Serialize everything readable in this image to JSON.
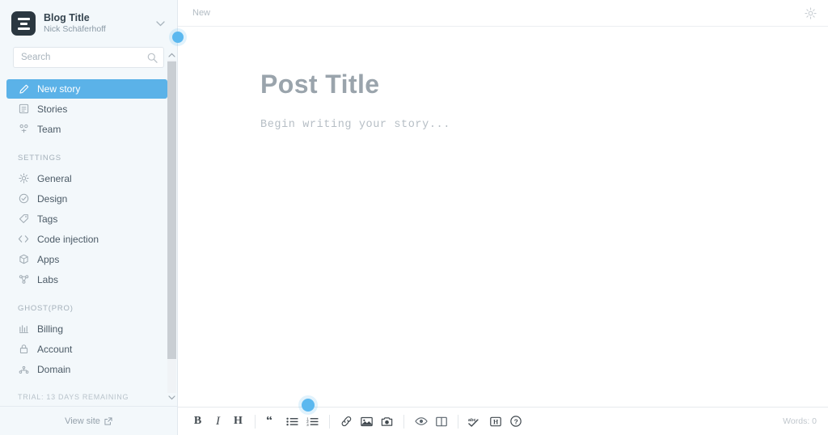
{
  "sidebar": {
    "blog": {
      "title": "Blog Title",
      "author": "Nick Schäferhoff",
      "logo_icon": "ghost-logo-icon",
      "chevron_icon": "chevron-down-icon"
    },
    "search": {
      "placeholder": "Search",
      "value": "",
      "icon": "search-icon"
    },
    "primary_items": [
      {
        "label": "New story",
        "icon": "pencil-icon",
        "active": true
      },
      {
        "label": "Stories",
        "icon": "content-list-icon",
        "active": false
      },
      {
        "label": "Team",
        "icon": "team-icon",
        "active": false
      }
    ],
    "settings_heading": "SETTINGS",
    "settings_items": [
      {
        "label": "General",
        "icon": "gear-icon"
      },
      {
        "label": "Design",
        "icon": "paintbrush-icon"
      },
      {
        "label": "Tags",
        "icon": "tag-icon"
      },
      {
        "label": "Code injection",
        "icon": "code-icon"
      },
      {
        "label": "Apps",
        "icon": "apps-cube-icon"
      },
      {
        "label": "Labs",
        "icon": "labs-molecule-icon"
      }
    ],
    "pro_heading": "GHOST(PRO)",
    "pro_items": [
      {
        "label": "Billing",
        "icon": "billing-icon"
      },
      {
        "label": "Account",
        "icon": "lock-icon"
      },
      {
        "label": "Domain",
        "icon": "domain-icon"
      }
    ],
    "trial_notice": "TRIAL: 13 DAYS REMAINING",
    "footer": {
      "view_site_label": "View site",
      "external_icon": "external-link-icon"
    },
    "scrollbar": {
      "up_icon": "chevron-up-icon",
      "down_icon": "chevron-down-icon"
    }
  },
  "topbar": {
    "title": "New",
    "settings_icon": "gear-icon"
  },
  "editor": {
    "title_placeholder": "Post Title",
    "body_placeholder": "Begin writing your story..."
  },
  "toolbar": {
    "groups": [
      [
        {
          "label": "B",
          "name": "bold-button",
          "kind": "text"
        },
        {
          "label": "I",
          "name": "italic-button",
          "kind": "text-italic"
        },
        {
          "label": "H",
          "name": "heading-button",
          "kind": "text"
        }
      ],
      [
        {
          "label": "“",
          "name": "blockquote-icon",
          "kind": "icon"
        },
        {
          "label": "",
          "name": "unordered-list-icon",
          "kind": "icon"
        },
        {
          "label": "",
          "name": "ordered-list-icon",
          "kind": "icon"
        }
      ],
      [
        {
          "label": "",
          "name": "link-icon",
          "kind": "icon"
        },
        {
          "label": "",
          "name": "image-icon",
          "kind": "icon"
        },
        {
          "label": "",
          "name": "camera-icon",
          "kind": "icon"
        }
      ],
      [
        {
          "label": "",
          "name": "preview-eye-icon",
          "kind": "icon"
        },
        {
          "label": "",
          "name": "split-pane-icon",
          "kind": "icon"
        }
      ],
      [
        {
          "label": "",
          "name": "spellcheck-icon",
          "kind": "icon"
        },
        {
          "label": "",
          "name": "markdown-icon",
          "kind": "icon"
        },
        {
          "label": "",
          "name": "help-icon",
          "kind": "icon"
        }
      ]
    ],
    "word_count": "Words: 0"
  },
  "handles": [
    {
      "name": "scroll-drag-handle"
    },
    {
      "name": "toolbar-drag-handle"
    }
  ],
  "colors": {
    "accent": "#5bb2e8",
    "handle": "#5bb8ef",
    "sidebar_bg": "#f3f8fb",
    "text": "#4b5a66"
  }
}
